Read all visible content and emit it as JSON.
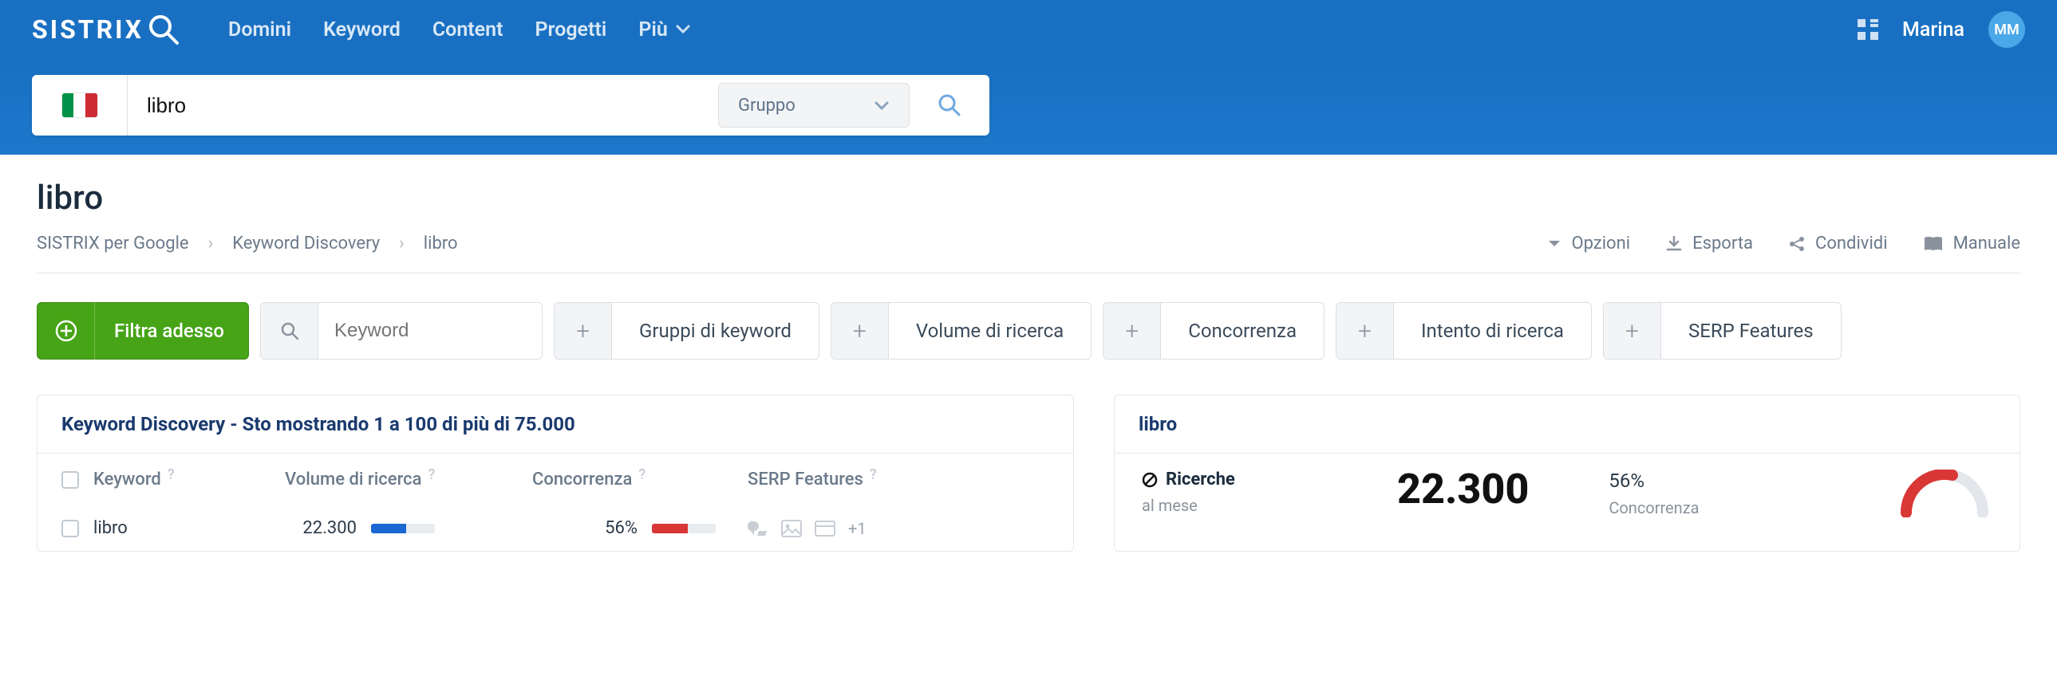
{
  "nav": {
    "logo": "SISTRIX",
    "links": [
      "Domini",
      "Keyword",
      "Content",
      "Progetti",
      "Più"
    ],
    "username": "Marina",
    "avatar_initials": "MM"
  },
  "search": {
    "value": "libro",
    "group_label": "Gruppo"
  },
  "page": {
    "title": "libro",
    "crumbs": [
      "SISTRIX per Google",
      "Keyword Discovery",
      "libro"
    ],
    "actions": {
      "options": "Opzioni",
      "export": "Esporta",
      "share": "Condividi",
      "manual": "Manuale"
    }
  },
  "filters": {
    "filter_now": "Filtra adesso",
    "keyword_placeholder": "Keyword",
    "chips": [
      "Gruppi di keyword",
      "Volume di ricerca",
      "Concorrenza",
      "Intento di ricerca",
      "SERP Features"
    ]
  },
  "table": {
    "heading": "Keyword Discovery - Sto mostrando 1 a 100 di più di 75.000",
    "cols": {
      "keyword": "Keyword",
      "volume": "Volume di ricerca",
      "competition": "Concorrenza",
      "serp": "SERP Features"
    },
    "rows": [
      {
        "keyword": "libro",
        "volume": "22.300",
        "volume_pct": 55,
        "competition": "56%",
        "competition_pct": 56,
        "extra": "+1"
      }
    ]
  },
  "detail": {
    "title": "libro",
    "ricerche_label": "Ricerche",
    "ricerche_sub": "al mese",
    "ricerche_value": "22.300",
    "conc_value": "56%",
    "conc_label": "Concorrenza"
  }
}
